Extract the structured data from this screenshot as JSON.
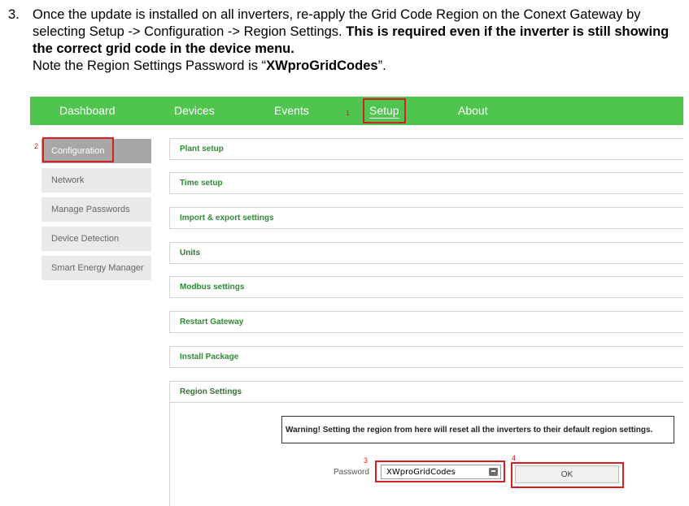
{
  "instruction": {
    "number": "3.",
    "part1": "Once the update is installed on all inverters, re-apply the Grid Code Region on the Conext Gateway by selecting Setup -> Configuration -> Region Settings. ",
    "bold1": "This is required even if the inverter is still showing the correct grid code in the device menu.",
    "part2": "Note the Region Settings Password is “",
    "bold2": "XWproGridCodes",
    "part3": "”."
  },
  "nav": {
    "items": [
      "Dashboard",
      "Devices",
      "Events",
      "Setup",
      "About"
    ]
  },
  "markers": [
    "1",
    "2",
    "3",
    "4"
  ],
  "sidebar": {
    "items": [
      "Configuration",
      "Network",
      "Manage Passwords",
      "Device Detection",
      "Smart Energy Manager"
    ]
  },
  "panels": [
    "Plant setup",
    "Time setup",
    "Import & export settings",
    "Units",
    "Modbus settings",
    "Restart Gateway",
    "Install Package",
    "Region Settings"
  ],
  "region": {
    "warning": "Warning! Setting the region from here will reset all the inverters to their default region settings.",
    "password_label": "Password",
    "password_value": "XWproGridCodes",
    "ok_label": "OK"
  },
  "colors": {
    "nav_bg": "#4fc44f",
    "highlight": "#d42020",
    "panel_title": "#2e8b35"
  }
}
